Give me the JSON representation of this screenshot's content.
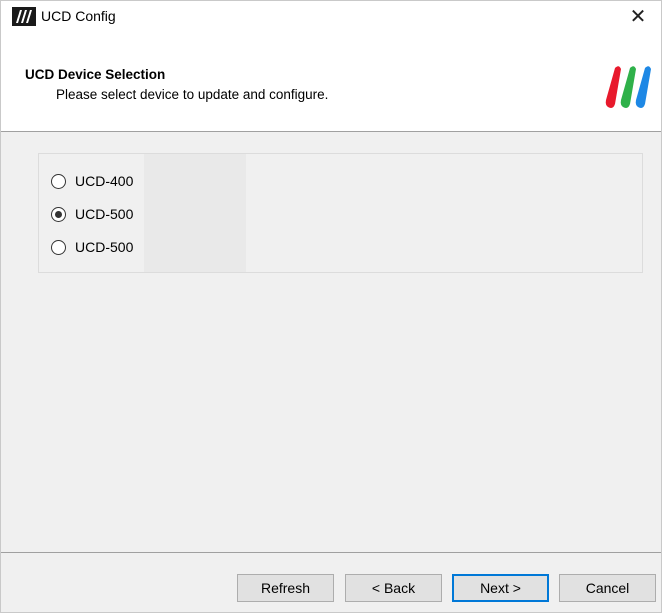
{
  "window": {
    "title": "UCD Config",
    "close_glyph": "✕"
  },
  "header": {
    "title": "UCD Device Selection",
    "subtitle": "Please select device to update and configure."
  },
  "devices": [
    {
      "label": "UCD-400",
      "selected": false
    },
    {
      "label": "UCD-500",
      "selected": true
    },
    {
      "label": "UCD-500",
      "selected": false
    }
  ],
  "buttons": {
    "refresh": "Refresh",
    "back": "< Back",
    "next": "Next >",
    "cancel": "Cancel"
  },
  "colors": {
    "brand_red": "#e8192c",
    "brand_green": "#2fb14a",
    "brand_blue": "#1e88e5",
    "focus_blue": "#0078d7"
  },
  "icons": {
    "app_logo": "ucd-logo-icon",
    "brand_logo": "brand-stripes-logo",
    "close": "close-icon"
  }
}
